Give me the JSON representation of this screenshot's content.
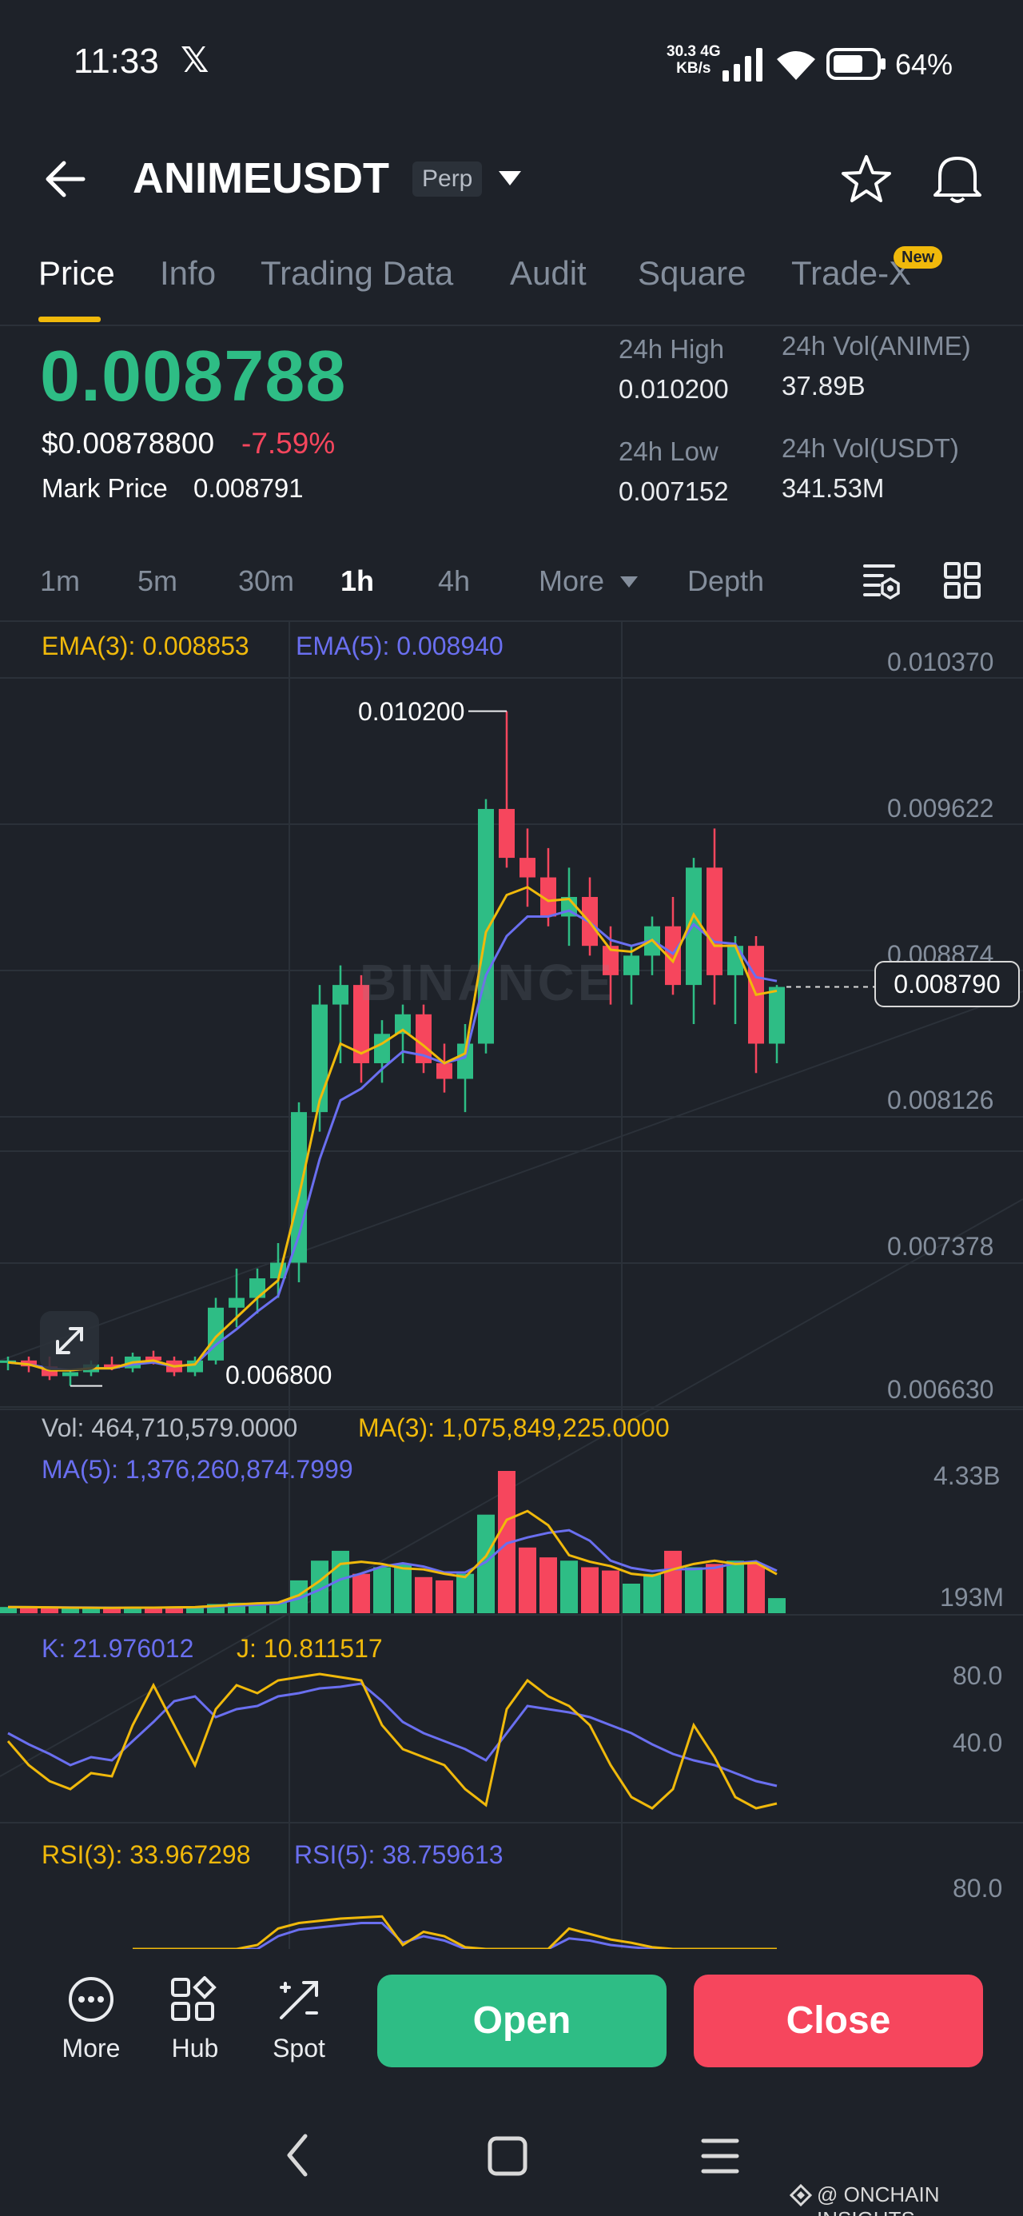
{
  "status_bar": {
    "time": "11:33",
    "x_glyph": "𝕏",
    "net_speed_top": "30.3 4G",
    "net_speed_bottom": "KB/s",
    "battery": "64%",
    "icons": [
      "signal-icon",
      "wifi-icon",
      "battery-icon"
    ]
  },
  "header": {
    "symbol": "ANIMEUSDT",
    "badge": "Perp",
    "icons": [
      "back-arrow-icon",
      "caret-down-icon",
      "star-icon",
      "bell-icon"
    ]
  },
  "tabs": [
    {
      "label": "Price",
      "active": true
    },
    {
      "label": "Info"
    },
    {
      "label": "Trading Data"
    },
    {
      "label": "Audit"
    },
    {
      "label": "Square"
    },
    {
      "label": "Trade-X"
    }
  ],
  "new_badge": "New",
  "price": {
    "last": "0.008788",
    "usd": "$0.00878800",
    "change": "-7.59%",
    "mark_label": "Mark Price",
    "mark_value": "0.008791"
  },
  "stats": {
    "high_label": "24h High",
    "high_value": "0.010200",
    "low_label": "24h Low",
    "low_value": "0.007152",
    "vol_base_label": "24h Vol(ANIME)",
    "vol_base_value": "37.89B",
    "vol_quote_label": "24h Vol(USDT)",
    "vol_quote_value": "341.53M"
  },
  "timeframes": [
    {
      "label": "1m"
    },
    {
      "label": "5m"
    },
    {
      "label": "30m"
    },
    {
      "label": "1h",
      "active": true
    },
    {
      "label": "4h"
    },
    {
      "label": "More"
    },
    {
      "label": "Depth"
    }
  ],
  "indicators": {
    "ema3": "EMA(3): 0.008853",
    "ema5": "EMA(5): 0.008940",
    "vol": "Vol: 464,710,579.0000",
    "vol_ma3": "MA(3): 1,075,849,225.0000",
    "vol_ma5": "MA(5): 1,376,260,874.7999",
    "kdj_k": "K: 21.976012",
    "kdj_j": "J: 10.811517",
    "rsi3": "RSI(3): 33.967298",
    "rsi5": "RSI(5): 38.759613"
  },
  "price_axis": [
    "0.010370",
    "0.009622",
    "0.008874",
    "0.008126",
    "0.007378",
    "0.006630"
  ],
  "vol_axis": [
    "4.33B",
    "193M"
  ],
  "kdj_axis": [
    "80.0",
    "40.0"
  ],
  "rsi_axis": [
    "80.0"
  ],
  "chart_marks": {
    "high": "0.010200",
    "low": "0.006800",
    "current": "0.008790",
    "watermark": "BINANCE"
  },
  "colors": {
    "up": "#2ebd85",
    "down": "#f6465d",
    "ema3": "#f0b90b",
    "ema5": "#6a6ff0",
    "accent": "#f0b90b"
  },
  "chart_data": {
    "type": "candlestick",
    "ylim": [
      0.00663,
      0.01037
    ],
    "candles": [
      {
        "o": 0.00687,
        "h": 0.0069,
        "l": 0.00683,
        "c": 0.00688
      },
      {
        "o": 0.00688,
        "h": 0.0069,
        "l": 0.00682,
        "c": 0.00685
      },
      {
        "o": 0.00685,
        "h": 0.0069,
        "l": 0.00678,
        "c": 0.0068
      },
      {
        "o": 0.0068,
        "h": 0.00683,
        "l": 0.00675,
        "c": 0.00682
      },
      {
        "o": 0.00682,
        "h": 0.00688,
        "l": 0.0068,
        "c": 0.00686
      },
      {
        "o": 0.00686,
        "h": 0.0069,
        "l": 0.00683,
        "c": 0.00684
      },
      {
        "o": 0.00684,
        "h": 0.00692,
        "l": 0.00682,
        "c": 0.0069
      },
      {
        "o": 0.0069,
        "h": 0.00693,
        "l": 0.00686,
        "c": 0.00688
      },
      {
        "o": 0.00688,
        "h": 0.0069,
        "l": 0.0068,
        "c": 0.00682
      },
      {
        "o": 0.00682,
        "h": 0.0069,
        "l": 0.0068,
        "c": 0.00688
      },
      {
        "o": 0.00688,
        "h": 0.0072,
        "l": 0.00686,
        "c": 0.00715
      },
      {
        "o": 0.00715,
        "h": 0.00735,
        "l": 0.00705,
        "c": 0.0072
      },
      {
        "o": 0.0072,
        "h": 0.00735,
        "l": 0.00712,
        "c": 0.0073
      },
      {
        "o": 0.0073,
        "h": 0.00748,
        "l": 0.0072,
        "c": 0.00738
      },
      {
        "o": 0.00738,
        "h": 0.0082,
        "l": 0.00728,
        "c": 0.00815
      },
      {
        "o": 0.00815,
        "h": 0.0088,
        "l": 0.00805,
        "c": 0.0087
      },
      {
        "o": 0.0087,
        "h": 0.0089,
        "l": 0.0084,
        "c": 0.0088
      },
      {
        "o": 0.0088,
        "h": 0.00885,
        "l": 0.0083,
        "c": 0.0084
      },
      {
        "o": 0.0084,
        "h": 0.00862,
        "l": 0.0083,
        "c": 0.00855
      },
      {
        "o": 0.00855,
        "h": 0.0087,
        "l": 0.0084,
        "c": 0.00865
      },
      {
        "o": 0.00865,
        "h": 0.0087,
        "l": 0.00835,
        "c": 0.0084
      },
      {
        "o": 0.0084,
        "h": 0.0085,
        "l": 0.00825,
        "c": 0.00832
      },
      {
        "o": 0.00832,
        "h": 0.0086,
        "l": 0.00815,
        "c": 0.0085
      },
      {
        "o": 0.0085,
        "h": 0.00975,
        "l": 0.00845,
        "c": 0.0097
      },
      {
        "o": 0.0097,
        "h": 0.0102,
        "l": 0.0094,
        "c": 0.00945
      },
      {
        "o": 0.00945,
        "h": 0.0096,
        "l": 0.0092,
        "c": 0.00935
      },
      {
        "o": 0.00935,
        "h": 0.0095,
        "l": 0.0091,
        "c": 0.00915
      },
      {
        "o": 0.00915,
        "h": 0.0094,
        "l": 0.009,
        "c": 0.00925
      },
      {
        "o": 0.00925,
        "h": 0.00935,
        "l": 0.00895,
        "c": 0.009
      },
      {
        "o": 0.009,
        "h": 0.0091,
        "l": 0.0087,
        "c": 0.00885
      },
      {
        "o": 0.00885,
        "h": 0.009,
        "l": 0.0087,
        "c": 0.00895
      },
      {
        "o": 0.00895,
        "h": 0.00915,
        "l": 0.00885,
        "c": 0.0091
      },
      {
        "o": 0.0091,
        "h": 0.00925,
        "l": 0.00875,
        "c": 0.0088
      },
      {
        "o": 0.0088,
        "h": 0.00945,
        "l": 0.0086,
        "c": 0.0094
      },
      {
        "o": 0.0094,
        "h": 0.0096,
        "l": 0.0087,
        "c": 0.00885
      },
      {
        "o": 0.00885,
        "h": 0.00905,
        "l": 0.0086,
        "c": 0.009
      },
      {
        "o": 0.009,
        "h": 0.00905,
        "l": 0.00835,
        "c": 0.0085
      },
      {
        "o": 0.0085,
        "h": 0.0088,
        "l": 0.0084,
        "c": 0.00879
      }
    ],
    "ema3": [
      0.00687,
      0.00686,
      0.00683,
      0.00683,
      0.00684,
      0.00684,
      0.00687,
      0.00688,
      0.00685,
      0.00686,
      0.007,
      0.0071,
      0.0072,
      0.00729,
      0.00772,
      0.00821,
      0.0085,
      0.00845,
      0.0085,
      0.00857,
      0.00849,
      0.0084,
      0.00845,
      0.00907,
      0.00926,
      0.0093,
      0.00923,
      0.00924,
      0.00912,
      0.00898,
      0.00897,
      0.00903,
      0.00892,
      0.00916,
      0.009,
      0.009,
      0.00875,
      0.00877
    ],
    "ema5": [
      0.00687,
      0.00686,
      0.00684,
      0.00683,
      0.00684,
      0.00684,
      0.00686,
      0.00687,
      0.00685,
      0.00686,
      0.00696,
      0.00704,
      0.00713,
      0.00721,
      0.00752,
      0.00791,
      0.00821,
      0.00827,
      0.00837,
      0.00846,
      0.00844,
      0.0084,
      0.00843,
      0.00885,
      0.00905,
      0.00915,
      0.00915,
      0.00918,
      0.00912,
      0.00903,
      0.009,
      0.00903,
      0.00896,
      0.00911,
      0.00902,
      0.00901,
      0.00884,
      0.00882
    ],
    "volume": [
      0.19,
      0.18,
      0.17,
      0.16,
      0.17,
      0.16,
      0.18,
      0.17,
      0.19,
      0.2,
      0.28,
      0.32,
      0.3,
      0.35,
      1.0,
      1.6,
      1.9,
      1.2,
      1.4,
      1.5,
      1.1,
      1.0,
      1.2,
      3.0,
      4.33,
      2.0,
      1.7,
      1.6,
      1.4,
      1.3,
      0.9,
      1.2,
      1.9,
      1.4,
      1.5,
      1.6,
      1.5,
      0.46
    ],
    "k": [
      55,
      48,
      42,
      35,
      40,
      38,
      50,
      62,
      75,
      78,
      65,
      70,
      72,
      78,
      80,
      83,
      84,
      86,
      75,
      62,
      55,
      50,
      45,
      38,
      55,
      72,
      70,
      68,
      65,
      60,
      55,
      48,
      42,
      38,
      35,
      30,
      25,
      22
    ],
    "j": [
      50,
      35,
      25,
      20,
      30,
      28,
      60,
      85,
      60,
      35,
      70,
      85,
      80,
      88,
      90,
      92,
      90,
      88,
      60,
      45,
      40,
      35,
      20,
      10,
      70,
      88,
      78,
      72,
      60,
      35,
      15,
      8,
      20,
      60,
      40,
      15,
      8,
      11
    ],
    "rsi3": [
      40,
      38,
      55,
      30,
      35,
      40,
      60,
      75,
      80,
      82,
      84,
      85,
      86,
      60,
      72,
      68,
      58,
      50,
      45,
      40,
      55,
      75,
      70,
      65,
      62,
      58,
      45,
      35,
      48,
      50,
      38,
      34
    ],
    "rsi5": [
      42,
      40,
      50,
      35,
      38,
      42,
      55,
      68,
      74,
      76,
      78,
      80,
      80,
      62,
      68,
      64,
      56,
      50,
      46,
      44,
      52,
      66,
      64,
      60,
      58,
      55,
      47,
      40,
      46,
      48,
      40,
      39
    ]
  },
  "bottom": {
    "more": "More",
    "hub": "Hub",
    "spot": "Spot",
    "open": "Open",
    "close": "Close"
  },
  "credit": "@ ONCHAIN INSIGHTS"
}
